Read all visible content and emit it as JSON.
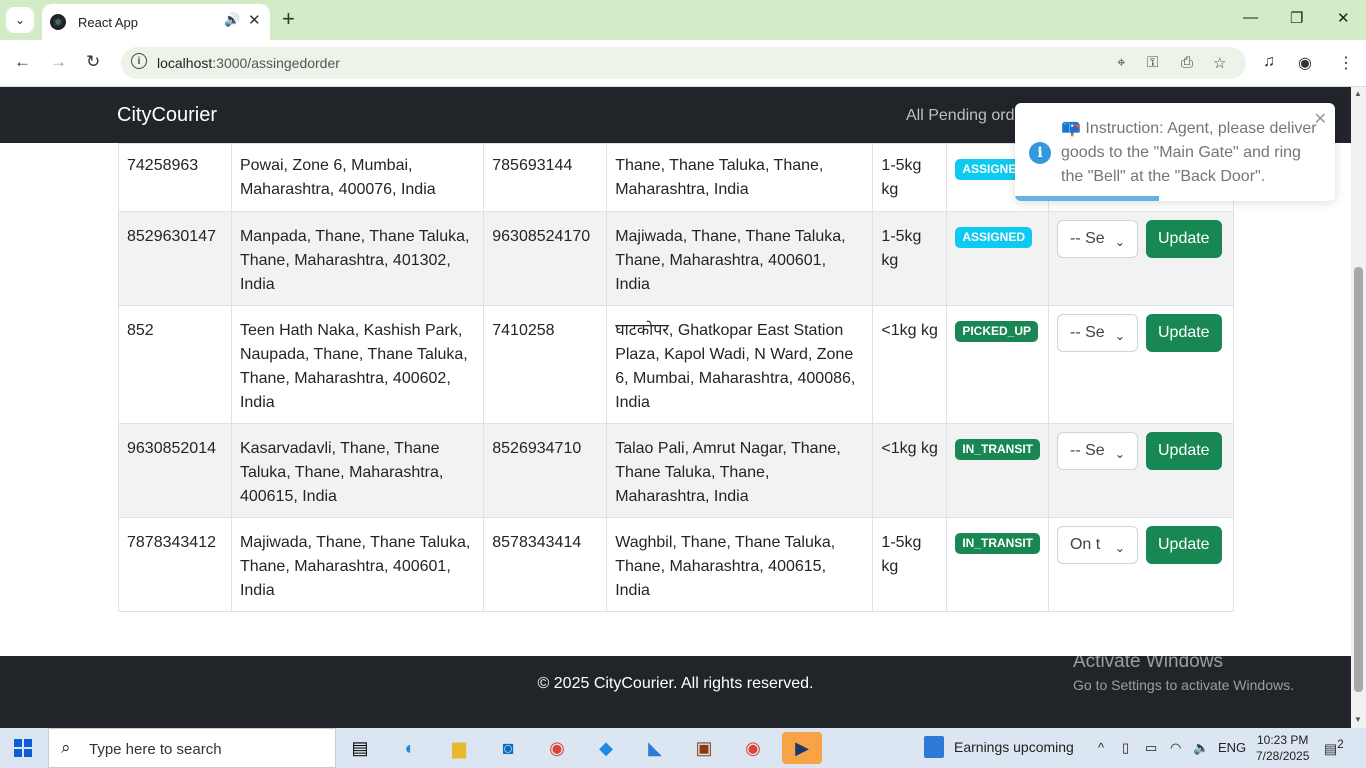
{
  "browser": {
    "tab_title": "React App",
    "url_host": "localhost",
    "url_path": ":3000/assingedorder"
  },
  "navbar": {
    "brand": "CityCourier",
    "link": "All Pending ord"
  },
  "rows": [
    {
      "sender_phone": "74258963",
      "pickup": "Powai, Zone 6, Mumbai, Maharashtra, 400076, India",
      "receiver_phone": "785693144",
      "drop": "Thane, Thane Taluka, Thane, Maharashtra, India",
      "weight": "1-5kg kg",
      "status": "ASSIGNED",
      "select": "",
      "update": ""
    },
    {
      "sender_phone": "8529630147",
      "pickup": "Manpada, Thane, Thane Taluka, Thane, Maharashtra, 401302, India",
      "receiver_phone": "96308524170",
      "drop": "Majiwada, Thane, Thane Taluka, Thane, Maharashtra, 400601, India",
      "weight": "1-5kg kg",
      "status": "ASSIGNED",
      "select": "-- Se",
      "update": "Update"
    },
    {
      "sender_phone": "852",
      "pickup": "Teen Hath Naka, Kashish Park, Naupada, Thane, Thane Taluka, Thane, Maharashtra, 400602, India",
      "receiver_phone": "7410258",
      "drop": "घाटकोपर, Ghatkopar East Station Plaza, Kapol Wadi, N Ward, Zone 6, Mumbai, Maharashtra, 400086, India",
      "weight": "<1kg kg",
      "status": "PICKED_UP",
      "select": "-- Se",
      "update": "Update"
    },
    {
      "sender_phone": "9630852014",
      "pickup": "Kasarvadavli, Thane, Thane Taluka, Thane, Maharashtra, 400615, India",
      "receiver_phone": "8526934710",
      "drop": "Talao Pali, Amrut Nagar, Thane, Thane Taluka, Thane, Maharashtra, India",
      "weight": "<1kg kg",
      "status": "IN_TRANSIT",
      "select": "-- Se",
      "update": "Update"
    },
    {
      "sender_phone": "7878343412",
      "pickup": "Majiwada, Thane, Thane Taluka, Thane, Maharashtra, 400601, India",
      "receiver_phone": "8578343414",
      "drop": "Waghbil, Thane, Thane Taluka, Thane, Maharashtra, 400615, India",
      "weight": "1-5kg kg",
      "status": "IN_TRANSIT",
      "select": "On t",
      "update": "Update"
    }
  ],
  "toast": {
    "message": "📪 Instruction: Agent, please deliver goods to the \"Main Gate\" and ring the \"Bell\" at the \"Back Door\".",
    "progress": 0.45
  },
  "footer": {
    "text": "© 2025 CityCourier. All rights reserved."
  },
  "watermark": {
    "title": "Activate Windows",
    "subtitle": "Go to Settings to activate Windows."
  },
  "taskbar": {
    "search_placeholder": "Type here to search",
    "news": "Earnings upcoming",
    "lang": "ENG",
    "time": "10:23 PM",
    "date": "7/28/2025",
    "notif_count": "2"
  },
  "colors": {
    "navbar": "#212529",
    "success": "#198754",
    "info": "#0dcaf0",
    "toast_accent": "#3498db",
    "tab_strip": "#d3ebc7"
  }
}
